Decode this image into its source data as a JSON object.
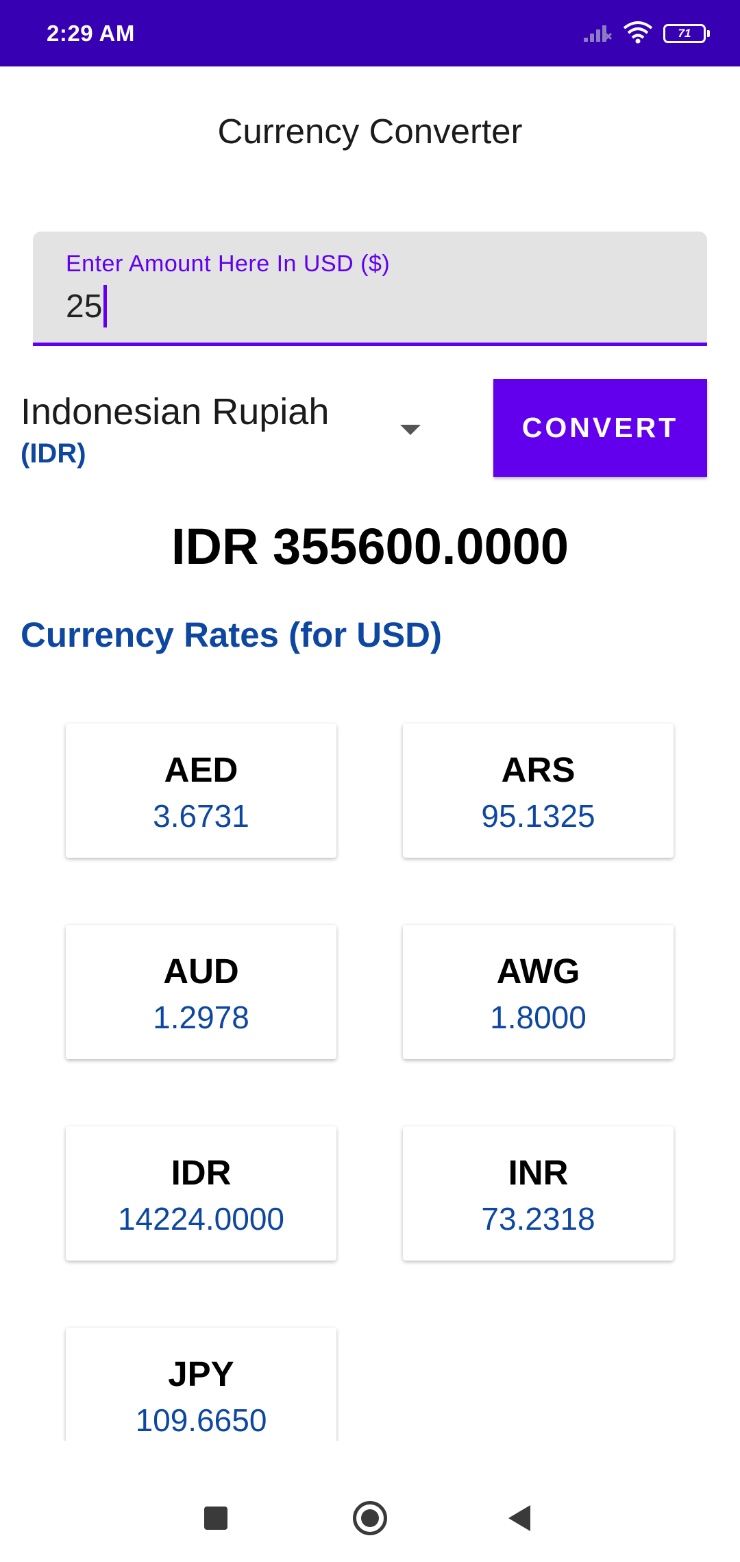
{
  "status_bar": {
    "time": "2:29 AM",
    "battery_level": "71",
    "icons": [
      "signal-icon",
      "wifi-icon",
      "battery-icon"
    ]
  },
  "app": {
    "title": "Currency Converter"
  },
  "amount_field": {
    "label": "Enter Amount Here In USD ($)",
    "value": "25"
  },
  "currency_select": {
    "selected_name": "Indonesian Rupiah",
    "selected_code": "(IDR)"
  },
  "convert_button": {
    "label": "CONVERT"
  },
  "result": {
    "text": "IDR 355600.0000"
  },
  "rates": {
    "header": "Currency Rates (for USD)",
    "items": [
      {
        "code": "AED",
        "value": "3.6731"
      },
      {
        "code": "ARS",
        "value": "95.1325"
      },
      {
        "code": "AUD",
        "value": "1.2978"
      },
      {
        "code": "AWG",
        "value": "1.8000"
      },
      {
        "code": "IDR",
        "value": "14224.0000"
      },
      {
        "code": "INR",
        "value": "73.2318"
      },
      {
        "code": "JPY",
        "value": "109.6650"
      }
    ]
  },
  "nav_bar": {
    "icons": [
      "recents-icon",
      "home-icon",
      "back-icon"
    ]
  },
  "colors": {
    "status_bar": "#3700b3",
    "primary": "#6200ee",
    "accent_blue": "#0d47a1"
  }
}
